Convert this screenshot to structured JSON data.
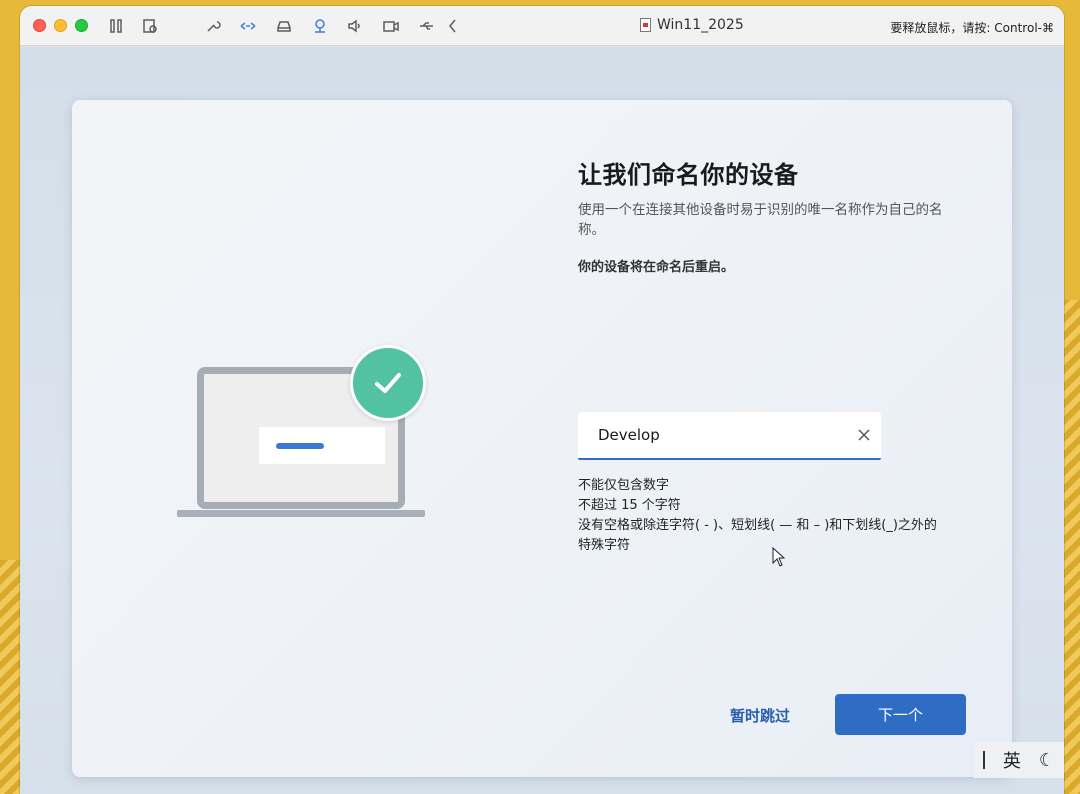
{
  "titlebar": {
    "window_title": "Win11_2025",
    "release_hint": "要释放鼠标，请按: Control-⌘",
    "tools": [
      "pause-icon",
      "snapshot-icon",
      "wrench-icon",
      "network-icon",
      "disk-icon",
      "webcam-icon",
      "speaker-icon",
      "camera-icon",
      "usb-icon",
      "back-chevron-icon"
    ]
  },
  "oobe": {
    "heading": "让我们命名你的设备",
    "description": "使用一个在连接其他设备时易于识别的唯一名称作为自己的名称。",
    "restart_note": "你的设备将在命名后重启。",
    "device_name_value": "Develop",
    "rules": [
      "不能仅包含数字",
      "不超过 15 个字符",
      "没有空格或除连字符( - )、短划线( — 和 – )和下划线(_)之外的",
      "特殊字符"
    ],
    "skip_label": "暂时跳过",
    "next_label": "下一个"
  },
  "ime": {
    "language": "英"
  },
  "colors": {
    "accent": "#2f6dc4",
    "check_badge": "#52c2a3"
  }
}
